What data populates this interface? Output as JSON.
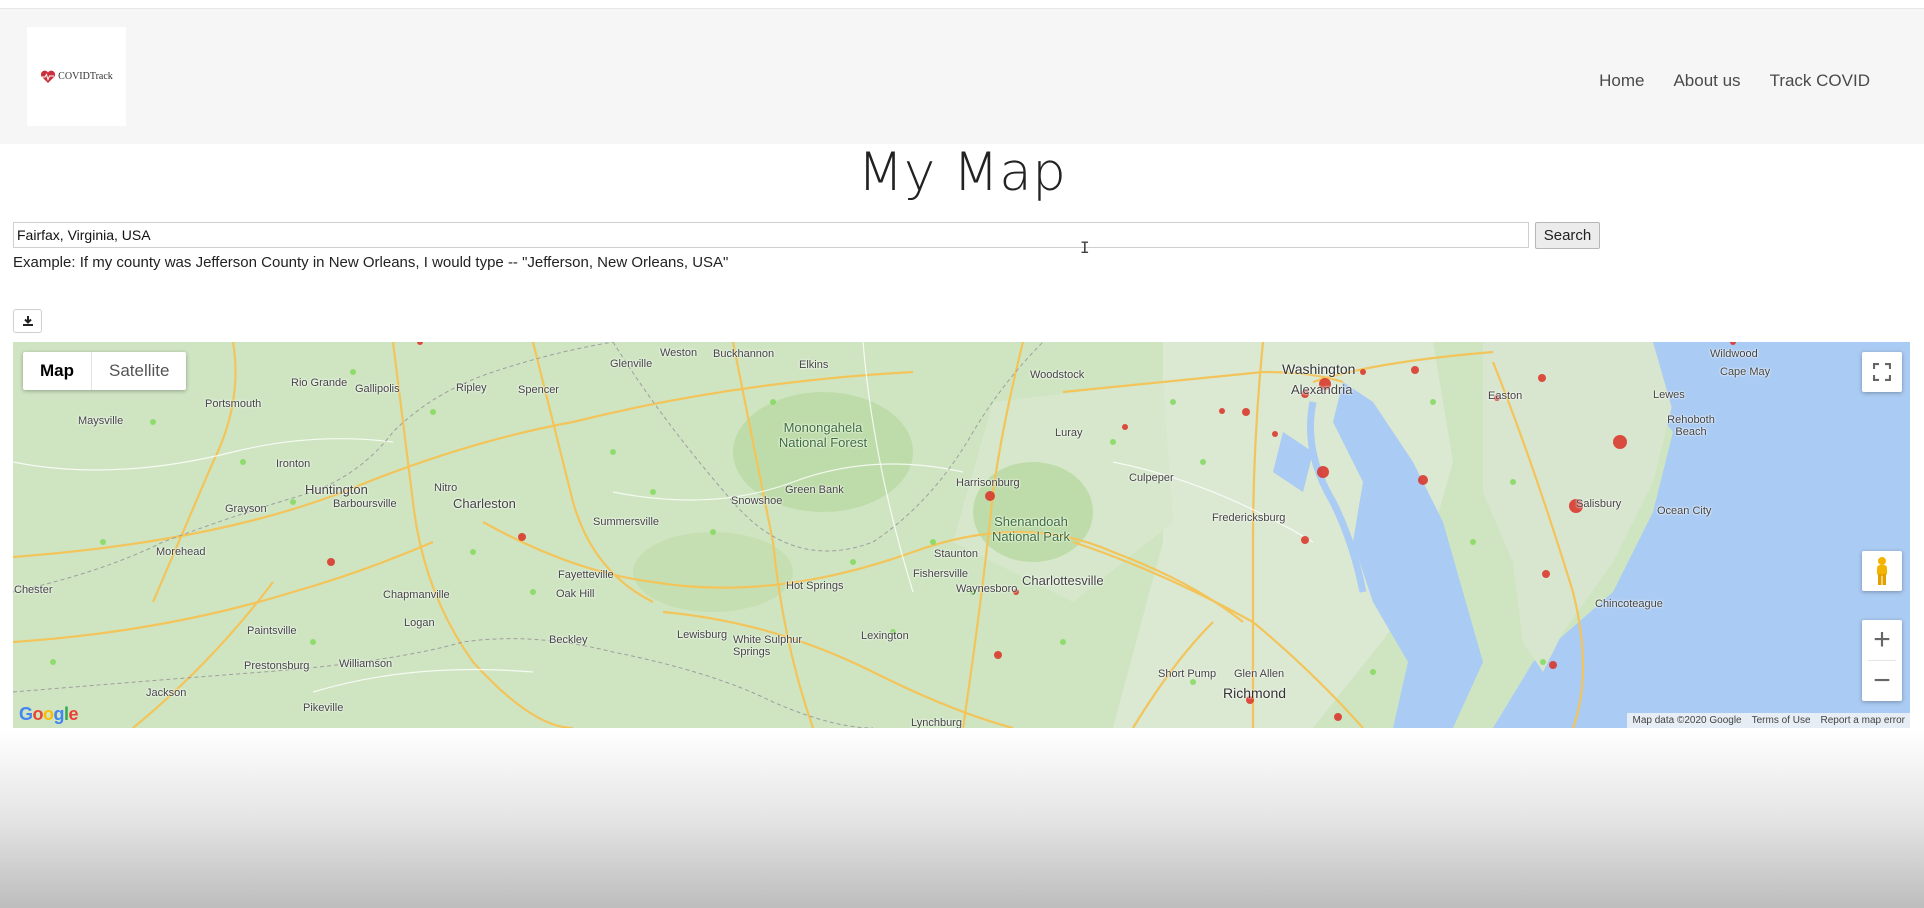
{
  "navbar": {
    "logo_text": "COVIDTrack",
    "links": [
      "Home",
      "About us",
      "Track COVID"
    ]
  },
  "page": {
    "title": "My Map"
  },
  "search": {
    "value": "Fairfax, Virginia, USA",
    "button_label": "Search",
    "hint": "Example: If my county was Jefferson County in New Orleans, I would type -- \"Jefferson, New Orleans, USA\""
  },
  "map": {
    "type_buttons": [
      "Map",
      "Satellite"
    ],
    "active_type": "Map",
    "zoom_in": "+",
    "zoom_out": "−",
    "google_logo": "Google",
    "attribution": [
      "Map data ©2020 Google",
      "Terms of Use",
      "Report a map error"
    ],
    "places": [
      "Washington",
      "Alexandria",
      "Maysville",
      "Portsmouth",
      "Rio Grande",
      "Gallipolis",
      "Ripley",
      "Spencer",
      "Glenville",
      "Weston",
      "Buckhannon",
      "Elkins",
      "Woodstock",
      "Easton",
      "Wildwood",
      "Cape May",
      "Lewes",
      "Rehoboth Beach",
      "Monongahela National Forest",
      "Ironton",
      "Huntington",
      "Barboursville",
      "Charleston",
      "Nitro",
      "Grayson",
      "Morehead",
      "Summersville",
      "Snowshoe",
      "Green Bank",
      "Harrisonburg",
      "Luray",
      "Culpeper",
      "Fredericksburg",
      "Salisbury",
      "Ocean City",
      "Shenandoah National Park",
      "Staunton",
      "Fishersville",
      "Waynesboro",
      "Charlottesville",
      "Fayetteville",
      "Oak Hill",
      "Chapmanville",
      "Logan",
      "Paintsville",
      "Prestonsburg",
      "Williamson",
      "Beckley",
      "Hot Springs",
      "Lewisburg",
      "White Sulphur Springs",
      "Lexington",
      "Jackson",
      "Pikeville",
      "Lynchburg",
      "Short Pump",
      "Glen Allen",
      "Richmond",
      "Chincoteague",
      "Jackson",
      "Chester"
    ]
  },
  "colors": {
    "navbar_bg": "#f6f6f7",
    "map_land": "#cfe5c2",
    "map_water": "#aacbf3",
    "hotspot": "#d93025",
    "hotspot_small": "#7ed957"
  }
}
